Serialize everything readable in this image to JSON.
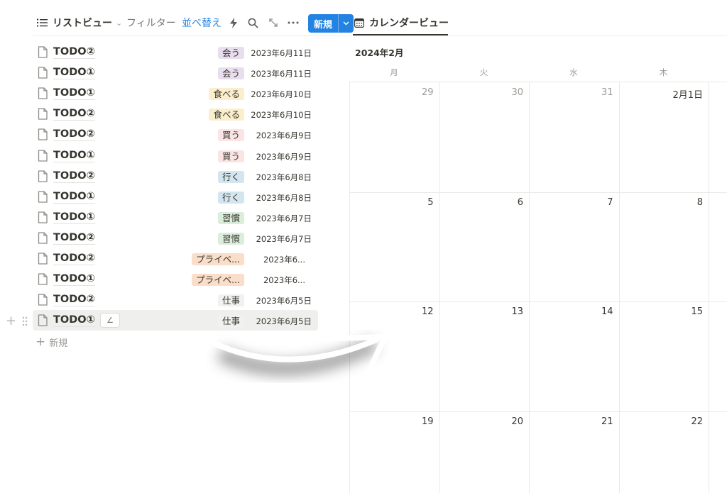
{
  "toolbar": {
    "list_view_label": "リストビュー",
    "filter_label": "フィルター",
    "sort_label": "並べ替え",
    "new_label": "新規",
    "calendar_tab_label": "カレンダービュー",
    "accent_color": "#2383e2"
  },
  "rows": [
    {
      "title": "TODO②",
      "tag": "会う",
      "tag_color": "#e8deee",
      "date": "2023年6月11日"
    },
    {
      "title": "TODO①",
      "tag": "会う",
      "tag_color": "#e8deee",
      "date": "2023年6月11日"
    },
    {
      "title": "TODO①",
      "tag": "食べる",
      "tag_color": "#fbeecc",
      "date": "2023年6月10日"
    },
    {
      "title": "TODO②",
      "tag": "食べる",
      "tag_color": "#fbeecc",
      "date": "2023年6月10日"
    },
    {
      "title": "TODO②",
      "tag": "買う",
      "tag_color": "#fbe4e4",
      "date": "2023年6月9日"
    },
    {
      "title": "TODO①",
      "tag": "買う",
      "tag_color": "#fbe4e4",
      "date": "2023年6月9日"
    },
    {
      "title": "TODO②",
      "tag": "行く",
      "tag_color": "#d3e5ef",
      "date": "2023年6月8日"
    },
    {
      "title": "TODO①",
      "tag": "行く",
      "tag_color": "#d3e5ef",
      "date": "2023年6月8日"
    },
    {
      "title": "TODO①",
      "tag": "習慣",
      "tag_color": "#dbeddb",
      "date": "2023年6月7日"
    },
    {
      "title": "TODO②",
      "tag": "習慣",
      "tag_color": "#dbeddb",
      "date": "2023年6月7日"
    },
    {
      "title": "TODO②",
      "tag": "プライベ...",
      "tag_color": "#fadec9",
      "date": "2023年6..."
    },
    {
      "title": "TODO①",
      "tag": "プライベ...",
      "tag_color": "#fadec9",
      "date": "2023年6..."
    },
    {
      "title": "TODO②",
      "tag": "仕事",
      "tag_color": "#f1f1ef",
      "date": "2023年6月5日"
    },
    {
      "title": "TODO①",
      "tag": "仕事",
      "tag_color": "#f1f1ef",
      "date": "2023年6月5日"
    }
  ],
  "list_new_label": "新規",
  "calendar": {
    "month_label": "2024年2月",
    "weekdays": [
      "月",
      "火",
      "水",
      "木"
    ],
    "weeks": [
      [
        "29",
        "30",
        "31",
        "2月1日"
      ],
      [
        "5",
        "6",
        "7",
        "8"
      ],
      [
        "12",
        "13",
        "14",
        "15"
      ],
      [
        "19",
        "20",
        "21",
        "22"
      ]
    ]
  }
}
